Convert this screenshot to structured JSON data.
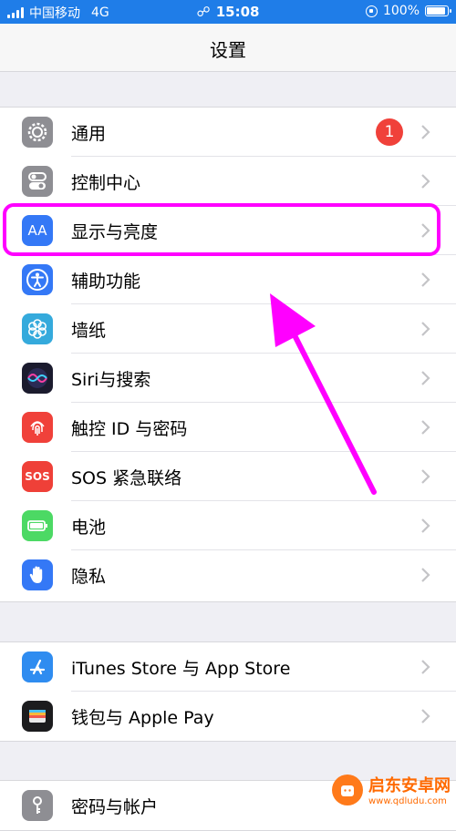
{
  "status_bar": {
    "carrier": "中国移动",
    "network": "4G",
    "time": "15:08",
    "battery": "100%"
  },
  "nav": {
    "title": "设置"
  },
  "group1": [
    {
      "label": "通用",
      "icon": "gear-icon",
      "badge": "1"
    },
    {
      "label": "控制中心",
      "icon": "toggle-switches-icon"
    },
    {
      "label": "显示与亮度",
      "icon": "text-size-icon",
      "icon_text": "AA"
    },
    {
      "label": "辅助功能",
      "icon": "accessibility-icon"
    },
    {
      "label": "墙纸",
      "icon": "flower-icon"
    },
    {
      "label": "Siri与搜索",
      "icon": "siri-icon"
    },
    {
      "label": "触控 ID 与密码",
      "icon": "fingerprint-icon"
    },
    {
      "label": "SOS 紧急联络",
      "icon": "sos-icon",
      "icon_text": "SOS"
    },
    {
      "label": "电池",
      "icon": "battery-icon"
    },
    {
      "label": "隐私",
      "icon": "hand-icon"
    }
  ],
  "group2": [
    {
      "label": "iTunes Store 与 App Store",
      "icon": "app-store-icon"
    },
    {
      "label": "钱包与 Apple Pay",
      "icon": "wallet-icon"
    }
  ],
  "group3": [
    {
      "label": "密码与帐户",
      "icon": "key-icon"
    }
  ],
  "watermark": {
    "title": "启东安卓网",
    "url": "www.qdludu.com"
  },
  "colors": {
    "status_bar": "#1f7de8",
    "highlight": "#ff00ff",
    "badge": "#f0413a"
  }
}
